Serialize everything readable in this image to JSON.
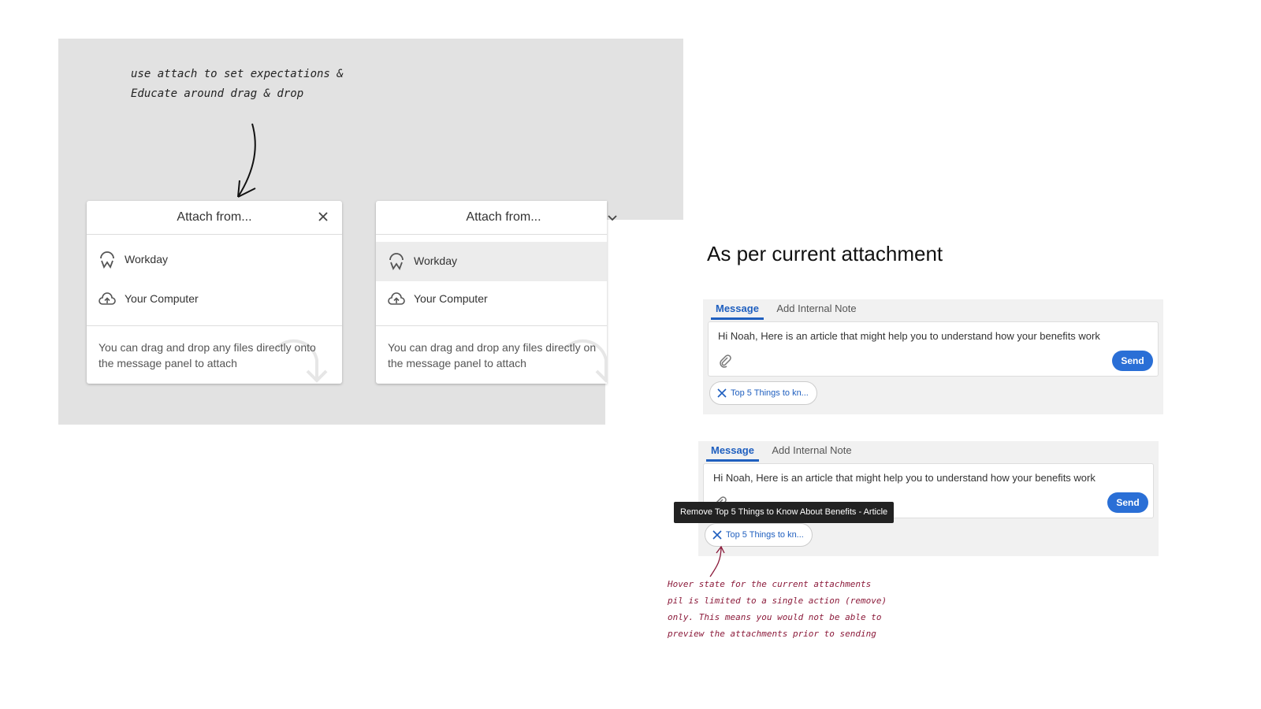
{
  "left_note": {
    "line1": "use attach to set expectations &",
    "line2": "Educate around drag & drop"
  },
  "panel_left": {
    "title": "Attach from...",
    "close_icon": "close-icon",
    "options": [
      {
        "label": "Workday",
        "icon": "workday-icon"
      },
      {
        "label": "Your Computer",
        "icon": "cloud-upload-icon"
      }
    ],
    "help_line1": "You can drag and drop any files directly onto",
    "help_line2": "the message panel to attach"
  },
  "panel_right": {
    "title": "Attach from...",
    "toggle_icon": "chevron-down-icon",
    "options": [
      {
        "label": "Workday",
        "icon": "workday-icon",
        "highlighted": true
      },
      {
        "label": "Your Computer",
        "icon": "cloud-upload-icon"
      }
    ],
    "help_line1": "You can drag and drop any files directly on",
    "help_line2": "the message panel to attach"
  },
  "right_heading": "As per current attachment",
  "composer1": {
    "tabs": [
      "Message",
      "Add Internal Note"
    ],
    "active_tab": 0,
    "text": "Hi Noah, Here is an article that might help you to understand how your benefits work",
    "send_label": "Send",
    "pill_label": "Top 5 Things to kn..."
  },
  "composer2": {
    "tabs": [
      "Message",
      "Add Internal Note"
    ],
    "active_tab": 0,
    "text": "Hi Noah, Here is an article that might help you to understand how your benefits work",
    "send_label": "Send",
    "pill_label": "Top 5 Things to kn...",
    "tooltip": "Remove Top 5 Things to Know About Benefits - Article"
  },
  "bottom_note": {
    "line1": "Hover state for the current attachments",
    "line2": "pil is limited to a single action (remove)",
    "line3": "only. This means you would not be able to",
    "line4": "preview the attachments prior to sending"
  },
  "colors": {
    "accent": "#2a6fd6",
    "canvas": "#e2e2e2",
    "note_red": "#8b1a3a"
  }
}
